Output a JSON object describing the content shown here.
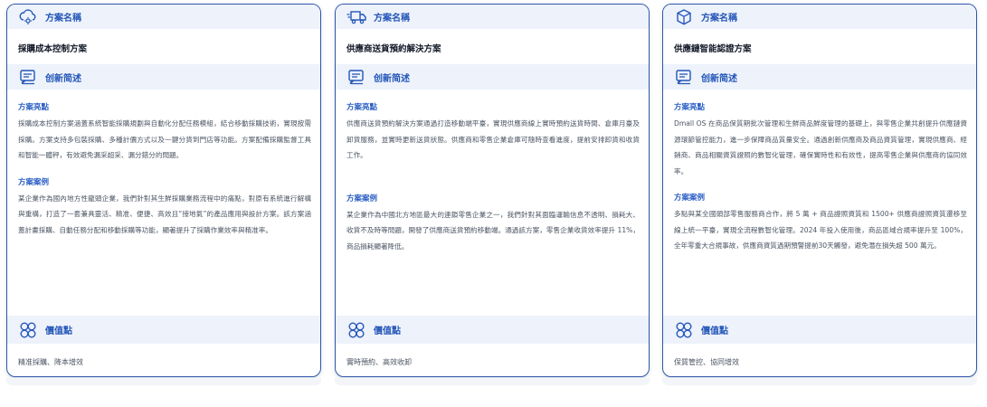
{
  "cards": [
    {
      "header_label": "方案名稱",
      "icon": "cloud-settings-icon",
      "name": "採購成本控制方案",
      "intro_label": "创新简述",
      "highlight_title": "方案亮點",
      "highlight_text": "採購成本控制方案涵蓋系統智能採購規劃與自動化分配任務模組，結合移動採購技術，實現按需採購。方案支持多包裝採購、多種計價方式以及一鍵分貨到門店等功能。方案配備採購監督工具和智能一體秤，有效避免漏采超采、漏分錯分的問題。",
      "case_title": "方案案例",
      "case_text": "某企業作為國內地方性龍頭企業，我們針對其生鮮採購業務流程中的痛點，對原有系統進行解構與重構，打造了一套兼具靈活、精准、便捷、高效且“接地氣”的產品應用與設計方案。該方案涵蓋計畫採購、自動任務分配和移動採購等功能，顯著提升了採購作業效率與精准率。",
      "value_label": "價值點",
      "value_text": "精准採購、降本增效"
    },
    {
      "header_label": "方案名稱",
      "icon": "delivery-truck-icon",
      "name": "供應商送貨預約解決方案",
      "intro_label": "创新简述",
      "highlight_title": "方案亮點",
      "highlight_text": "供應商送貨預約解決方案通過打造移動端平臺，實現供應商線上實時預約送貨時間、倉庫月臺及卸貨服務，並實時更新送貨狀態。供應商和零售企業倉庫可隨時查看進度，提前安排卸貨和收貨工作。",
      "case_title": "方案案例",
      "case_text": "某企業作為中國北方地區最大的連鎖零售企業之一，我們針對其面臨運輸信息不透明、損耗大、收貨不及時等問題，開發了供應商送貨預約移動端。通過該方案，零售企業收貨效率提升 11%，商品損耗顯著降低。",
      "value_label": "價值點",
      "value_text": "實時預約、高效收卸"
    },
    {
      "header_label": "方案名稱",
      "icon": "package-box-icon",
      "name": "供應鏈智能認證方案",
      "intro_label": "创新简述",
      "highlight_title": "方案亮點",
      "highlight_text": "Dmall OS 在商品保質期批次管理和生鮮商品鮮度管理的基礎上，與零售企業共創提升供應鏈資源環節管控能力，進一步保障商品質量安全。通過創新供應商及商品資質管理，實現供應商、經銷商、商品相關資質證照的數智化管理，確保實時性和有效性，提高零售企業與供應商的協同效率。",
      "case_title": "方案案例",
      "case_text": "多點與某全國頭部零售服務商合作，將 5 萬 + 商品證照資質和 1500+ 供應商證照資質遷移至線上統一平臺，實現全流程數智化管理。2024 年投入使用後，商品區域合規率提升至 100%，全年零重大合規事故，供應商資質過期預警提前30天觸發，避免潛在損失超 500 萬元。",
      "value_label": "價值點",
      "value_text": "保質管控、協同增效"
    }
  ]
}
